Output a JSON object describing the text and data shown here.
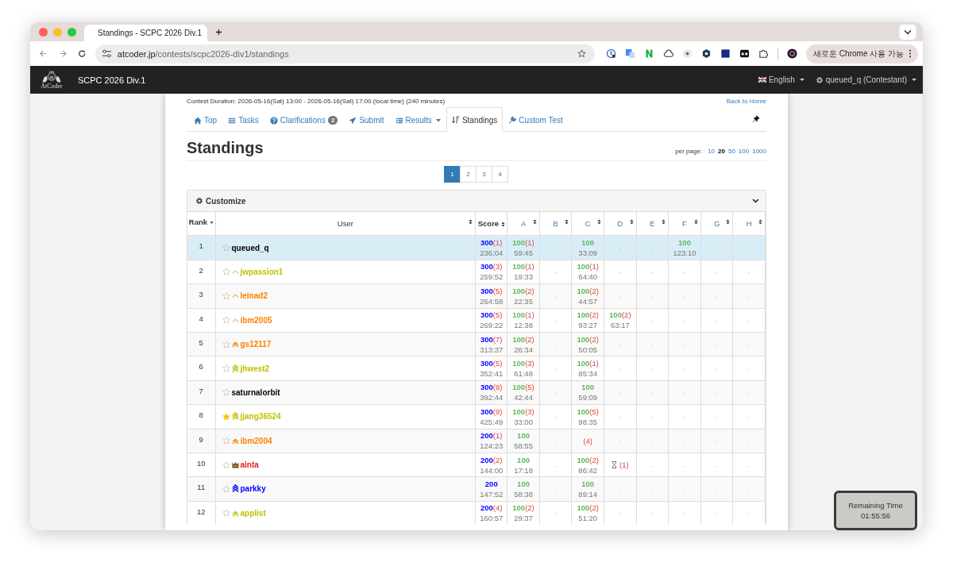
{
  "browser": {
    "tab_title": "Standings - SCPC 2026 Div.1",
    "url_host": "atcoder.jp",
    "url_path": "/contests/scpc2026-div1/standings",
    "update_button": "새로운 Chrome 사용 가능"
  },
  "navbar": {
    "logo_text": "AtCoder",
    "contest_title": "SCPC 2026 Div.1",
    "language": "English",
    "user": "queued_q (Contestant)"
  },
  "contest_duration": "Contest Duration: 2026-05-16(Sat) 13:00 - 2026-05-16(Sat) 17:00 (local time) (240 minutes)",
  "back_link": "Back to Home",
  "tabs": [
    {
      "label": "Top",
      "selected": false,
      "dropdown": false
    },
    {
      "label": "Tasks",
      "selected": false,
      "dropdown": false
    },
    {
      "label": "Clarifications",
      "badge": "2",
      "selected": false,
      "dropdown": false
    },
    {
      "label": "Submit",
      "selected": false,
      "dropdown": false
    },
    {
      "label": "Results",
      "selected": false,
      "dropdown": true
    },
    {
      "label": "Standings",
      "selected": true,
      "dropdown": false
    },
    {
      "label": "Custom Test",
      "selected": false,
      "dropdown": false
    }
  ],
  "heading": "Standings",
  "per_page": {
    "label": "per page:",
    "options": [
      {
        "label": "10",
        "selected": false
      },
      {
        "label": "20",
        "selected": true
      },
      {
        "label": "50",
        "selected": false
      },
      {
        "label": "100",
        "selected": false
      },
      {
        "label": "1000",
        "selected": false
      }
    ]
  },
  "pages": [
    {
      "label": "1",
      "selected": true
    },
    {
      "label": "2",
      "selected": false
    },
    {
      "label": "3",
      "selected": false
    },
    {
      "label": "4",
      "selected": false
    }
  ],
  "customize": "Customize",
  "columns": [
    {
      "label": "Rank",
      "kind": "rank"
    },
    {
      "label": "User",
      "kind": "user"
    },
    {
      "label": "Score",
      "kind": "score"
    },
    {
      "label": "A",
      "kind": "task"
    },
    {
      "label": "B",
      "kind": "task"
    },
    {
      "label": "C",
      "kind": "task"
    },
    {
      "label": "D",
      "kind": "task"
    },
    {
      "label": "E",
      "kind": "task"
    },
    {
      "label": "F",
      "kind": "task"
    },
    {
      "label": "G",
      "kind": "task"
    },
    {
      "label": "H",
      "kind": "task"
    }
  ],
  "rows": [
    {
      "rank": "1",
      "user": "queued_q",
      "color": "#000000",
      "favorite": false,
      "highlighted": true,
      "score": {
        "points": "300",
        "penalty": "(1)",
        "time": "236:04"
      },
      "tasks": [
        {
          "kind": "ac",
          "points": "100",
          "penalty": "(1)",
          "time": "59:45"
        },
        {
          "kind": "none",
          "text": "-"
        },
        {
          "kind": "ac",
          "points": "100",
          "time": "33:09"
        },
        {
          "kind": "none",
          "text": "-"
        },
        {
          "kind": "none",
          "text": "-"
        },
        {
          "kind": "ac",
          "points": "100",
          "time": "123:10"
        },
        {
          "kind": "none",
          "text": "-"
        },
        {
          "kind": "none",
          "text": "-"
        }
      ]
    },
    {
      "rank": "2",
      "user": "jwpassion1",
      "color": "#c0c000",
      "badge": {
        "kind": "chevron1"
      },
      "favorite": false,
      "highlighted": false,
      "score": {
        "points": "300",
        "penalty": "(3)",
        "time": "259:52"
      },
      "tasks": [
        {
          "kind": "ac",
          "points": "100",
          "penalty": "(1)",
          "time": "19:33"
        },
        {
          "kind": "none",
          "text": "-"
        },
        {
          "kind": "ac",
          "points": "100",
          "penalty": "(1)",
          "time": "64:40"
        },
        {
          "kind": "none",
          "text": "-"
        },
        {
          "kind": "none",
          "text": "-"
        },
        {
          "kind": "none",
          "text": "-"
        },
        {
          "kind": "none",
          "text": "-"
        },
        {
          "kind": "none",
          "text": "-"
        }
      ]
    },
    {
      "rank": "3",
      "user": "leinad2",
      "color": "#ff8000",
      "badge": {
        "kind": "chevron1"
      },
      "favorite": false,
      "highlighted": false,
      "score": {
        "points": "300",
        "penalty": "(5)",
        "time": "264:58"
      },
      "tasks": [
        {
          "kind": "ac",
          "points": "100",
          "penalty": "(2)",
          "time": "22:35"
        },
        {
          "kind": "none",
          "text": "-"
        },
        {
          "kind": "ac",
          "points": "100",
          "penalty": "(2)",
          "time": "44:57"
        },
        {
          "kind": "none",
          "text": "-"
        },
        {
          "kind": "none",
          "text": "-"
        },
        {
          "kind": "none",
          "text": "-"
        },
        {
          "kind": "none",
          "text": "-"
        },
        {
          "kind": "none",
          "text": "-"
        }
      ]
    },
    {
      "rank": "4",
      "user": "ibm2005",
      "color": "#ff8000",
      "badge": {
        "kind": "chevron1"
      },
      "favorite": false,
      "highlighted": false,
      "score": {
        "points": "300",
        "penalty": "(5)",
        "time": "269:22"
      },
      "tasks": [
        {
          "kind": "ac",
          "points": "100",
          "penalty": "(1)",
          "time": "12:38"
        },
        {
          "kind": "none",
          "text": "-"
        },
        {
          "kind": "ac",
          "points": "100",
          "penalty": "(2)",
          "time": "93:27"
        },
        {
          "kind": "ac",
          "points": "100",
          "penalty": "(2)",
          "time": "63:17"
        },
        {
          "kind": "none",
          "text": "-"
        },
        {
          "kind": "none",
          "text": "-"
        },
        {
          "kind": "none",
          "text": "-"
        },
        {
          "kind": "none",
          "text": "-"
        }
      ]
    },
    {
      "rank": "5",
      "user": "gs12117",
      "color": "#ff8000",
      "badge": {
        "kind": "chevron2"
      },
      "favorite": false,
      "highlighted": false,
      "score": {
        "points": "300",
        "penalty": "(7)",
        "time": "313:37"
      },
      "tasks": [
        {
          "kind": "ac",
          "points": "100",
          "penalty": "(2)",
          "time": "26:34"
        },
        {
          "kind": "none",
          "text": "-"
        },
        {
          "kind": "ac",
          "points": "100",
          "penalty": "(2)",
          "time": "50:05"
        },
        {
          "kind": "none",
          "text": "-"
        },
        {
          "kind": "none",
          "text": "-"
        },
        {
          "kind": "none",
          "text": "-"
        },
        {
          "kind": "none",
          "text": "-"
        },
        {
          "kind": "none",
          "text": "-"
        }
      ]
    },
    {
      "rank": "6",
      "user": "jhwest2",
      "color": "#c0c000",
      "badge": {
        "kind": "chevron3"
      },
      "favorite": false,
      "highlighted": false,
      "score": {
        "points": "300",
        "penalty": "(5)",
        "time": "352:41"
      },
      "tasks": [
        {
          "kind": "ac",
          "points": "100",
          "penalty": "(3)",
          "time": "61:48"
        },
        {
          "kind": "none",
          "text": "-"
        },
        {
          "kind": "ac",
          "points": "100",
          "penalty": "(1)",
          "time": "85:34"
        },
        {
          "kind": "none",
          "text": "-"
        },
        {
          "kind": "none",
          "text": "-"
        },
        {
          "kind": "none",
          "text": "-"
        },
        {
          "kind": "none",
          "text": "-"
        },
        {
          "kind": "none",
          "text": "-"
        }
      ]
    },
    {
      "rank": "7",
      "user": "saturnalorbit",
      "color": "#000000",
      "favorite": false,
      "highlighted": false,
      "score": {
        "points": "300",
        "penalty": "(9)",
        "time": "392:44"
      },
      "tasks": [
        {
          "kind": "ac",
          "points": "100",
          "penalty": "(5)",
          "time": "42:44"
        },
        {
          "kind": "none",
          "text": "-"
        },
        {
          "kind": "ac",
          "points": "100",
          "time": "59:09"
        },
        {
          "kind": "none",
          "text": "-"
        },
        {
          "kind": "none",
          "text": "-"
        },
        {
          "kind": "none",
          "text": "-"
        },
        {
          "kind": "none",
          "text": "-"
        },
        {
          "kind": "none",
          "text": "-"
        }
      ]
    },
    {
      "rank": "8",
      "user": "jjang36524",
      "color": "#c0c000",
      "badge": {
        "kind": "chevron3"
      },
      "favorite": true,
      "highlighted": false,
      "score": {
        "points": "300",
        "penalty": "(9)",
        "time": "425:49"
      },
      "tasks": [
        {
          "kind": "ac",
          "points": "100",
          "penalty": "(3)",
          "time": "33:00"
        },
        {
          "kind": "none",
          "text": "-"
        },
        {
          "kind": "ac",
          "points": "100",
          "penalty": "(5)",
          "time": "98:35"
        },
        {
          "kind": "none",
          "text": "-"
        },
        {
          "kind": "none",
          "text": "-"
        },
        {
          "kind": "none",
          "text": "-"
        },
        {
          "kind": "none",
          "text": "-"
        },
        {
          "kind": "none",
          "text": "-"
        }
      ]
    },
    {
      "rank": "9",
      "user": "ibm2004",
      "color": "#ff8000",
      "badge": {
        "kind": "chevron2"
      },
      "favorite": false,
      "highlighted": false,
      "score": {
        "points": "200",
        "penalty": "(1)",
        "time": "124:23"
      },
      "tasks": [
        {
          "kind": "ac",
          "points": "100",
          "time": "58:55"
        },
        {
          "kind": "none",
          "text": "-"
        },
        {
          "kind": "wa",
          "penalty": "(4)"
        },
        {
          "kind": "none",
          "text": "-"
        },
        {
          "kind": "none",
          "text": "-"
        },
        {
          "kind": "none",
          "text": "-"
        },
        {
          "kind": "none",
          "text": "-"
        },
        {
          "kind": "none",
          "text": "-"
        }
      ]
    },
    {
      "rank": "10",
      "user": "ainta",
      "color": "#e02020",
      "badge": {
        "kind": "crown"
      },
      "favorite": false,
      "highlighted": false,
      "score": {
        "points": "200",
        "penalty": "(2)",
        "time": "144:00"
      },
      "tasks": [
        {
          "kind": "ac",
          "points": "100",
          "time": "17:18"
        },
        {
          "kind": "none",
          "text": "-"
        },
        {
          "kind": "ac",
          "points": "100",
          "penalty": "(2)",
          "time": "86:42"
        },
        {
          "kind": "pending",
          "penalty": "(1)"
        },
        {
          "kind": "none",
          "text": "-"
        },
        {
          "kind": "none",
          "text": "-"
        },
        {
          "kind": "none",
          "text": "-"
        },
        {
          "kind": "none",
          "text": "-"
        }
      ]
    },
    {
      "rank": "11",
      "user": "parkky",
      "color": "#0000ff",
      "badge": {
        "kind": "chevron3"
      },
      "favorite": false,
      "highlighted": false,
      "score": {
        "points": "200",
        "time": "147:52"
      },
      "tasks": [
        {
          "kind": "ac",
          "points": "100",
          "time": "58:38"
        },
        {
          "kind": "none",
          "text": "-"
        },
        {
          "kind": "ac",
          "points": "100",
          "time": "89:14"
        },
        {
          "kind": "none",
          "text": "-"
        },
        {
          "kind": "none",
          "text": "-"
        },
        {
          "kind": "none",
          "text": "-"
        },
        {
          "kind": "none",
          "text": "-"
        },
        {
          "kind": "none",
          "text": "-"
        }
      ]
    },
    {
      "rank": "12",
      "user": "applist",
      "color": "#c0c000",
      "badge": {
        "kind": "chevron2"
      },
      "favorite": false,
      "highlighted": false,
      "score": {
        "points": "200",
        "penalty": "(4)",
        "time": "160:57"
      },
      "tasks": [
        {
          "kind": "ac",
          "points": "100",
          "penalty": "(2)",
          "time": "29:37"
        },
        {
          "kind": "none",
          "text": "-"
        },
        {
          "kind": "ac",
          "points": "100",
          "penalty": "(2)",
          "time": "51:20"
        },
        {
          "kind": "none",
          "text": "-"
        },
        {
          "kind": "none",
          "text": "-"
        },
        {
          "kind": "none",
          "text": "-"
        },
        {
          "kind": "none",
          "text": "-"
        },
        {
          "kind": "none",
          "text": "-"
        }
      ]
    }
  ],
  "remaining_time": {
    "label": "Remaining Time",
    "value": "01:55:56"
  }
}
